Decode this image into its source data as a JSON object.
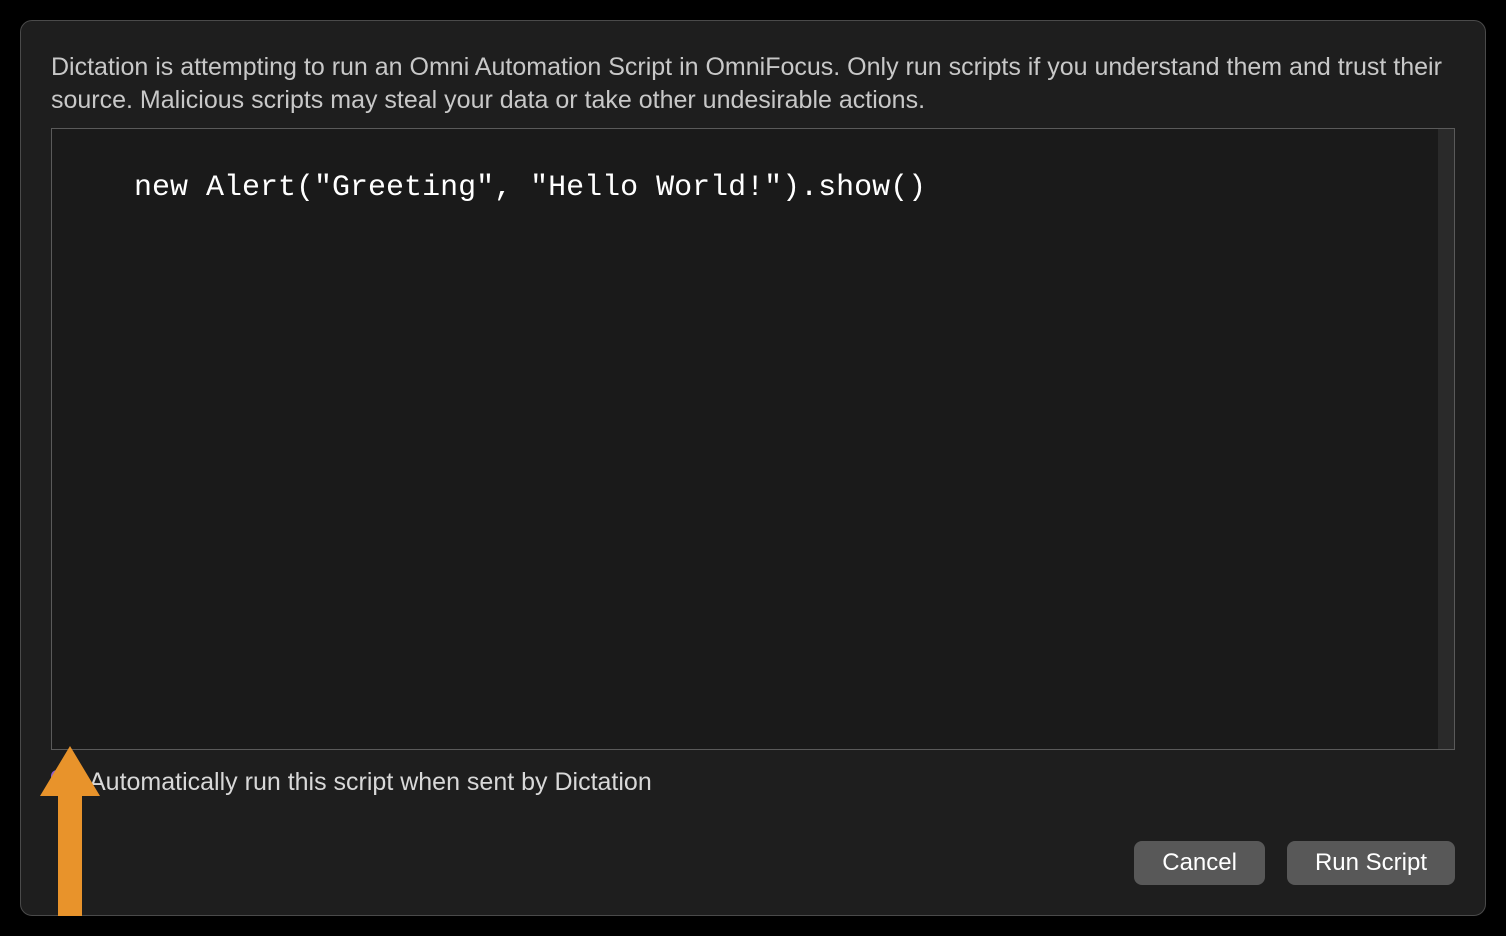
{
  "warning_text": "Dictation is attempting to run an Omni Automation Script in OmniFocus. Only run scripts if you understand them and trust their source. Malicious scripts may steal your data or take other undesirable actions.",
  "script_content": "new Alert(\"Greeting\", \"Hello World!\").show()",
  "checkbox": {
    "label": "Automatically run this script when sent by Dictation",
    "checked": true
  },
  "buttons": {
    "cancel": "Cancel",
    "run": "Run Script"
  },
  "colors": {
    "checkbox_accent": "#915dca",
    "arrow": "#E8932B"
  }
}
